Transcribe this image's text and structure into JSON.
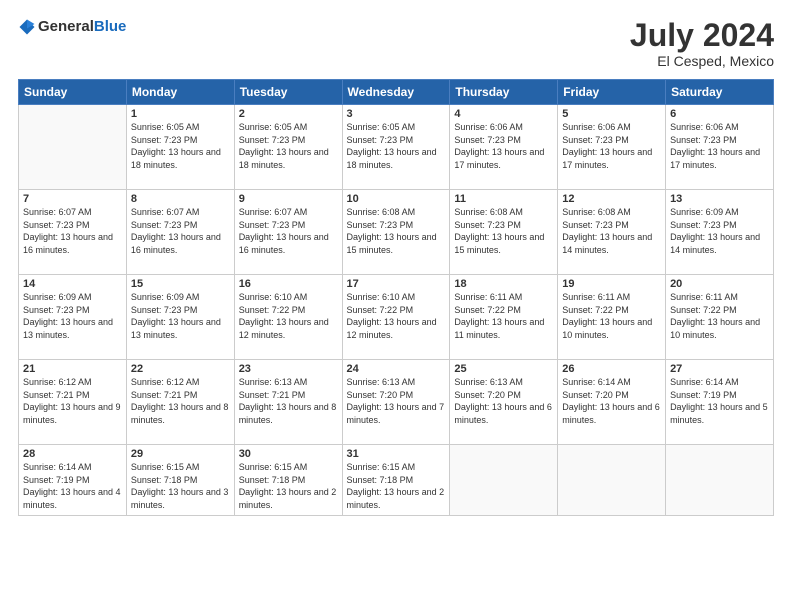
{
  "header": {
    "logo_general": "General",
    "logo_blue": "Blue",
    "month": "July 2024",
    "location": "El Cesped, Mexico"
  },
  "days_of_week": [
    "Sunday",
    "Monday",
    "Tuesday",
    "Wednesday",
    "Thursday",
    "Friday",
    "Saturday"
  ],
  "weeks": [
    [
      {
        "day": "",
        "empty": true
      },
      {
        "day": "1",
        "sunrise": "Sunrise: 6:05 AM",
        "sunset": "Sunset: 7:23 PM",
        "daylight": "Daylight: 13 hours and 18 minutes."
      },
      {
        "day": "2",
        "sunrise": "Sunrise: 6:05 AM",
        "sunset": "Sunset: 7:23 PM",
        "daylight": "Daylight: 13 hours and 18 minutes."
      },
      {
        "day": "3",
        "sunrise": "Sunrise: 6:05 AM",
        "sunset": "Sunset: 7:23 PM",
        "daylight": "Daylight: 13 hours and 18 minutes."
      },
      {
        "day": "4",
        "sunrise": "Sunrise: 6:06 AM",
        "sunset": "Sunset: 7:23 PM",
        "daylight": "Daylight: 13 hours and 17 minutes."
      },
      {
        "day": "5",
        "sunrise": "Sunrise: 6:06 AM",
        "sunset": "Sunset: 7:23 PM",
        "daylight": "Daylight: 13 hours and 17 minutes."
      },
      {
        "day": "6",
        "sunrise": "Sunrise: 6:06 AM",
        "sunset": "Sunset: 7:23 PM",
        "daylight": "Daylight: 13 hours and 17 minutes."
      }
    ],
    [
      {
        "day": "7",
        "sunrise": "Sunrise: 6:07 AM",
        "sunset": "Sunset: 7:23 PM",
        "daylight": "Daylight: 13 hours and 16 minutes."
      },
      {
        "day": "8",
        "sunrise": "Sunrise: 6:07 AM",
        "sunset": "Sunset: 7:23 PM",
        "daylight": "Daylight: 13 hours and 16 minutes."
      },
      {
        "day": "9",
        "sunrise": "Sunrise: 6:07 AM",
        "sunset": "Sunset: 7:23 PM",
        "daylight": "Daylight: 13 hours and 16 minutes."
      },
      {
        "day": "10",
        "sunrise": "Sunrise: 6:08 AM",
        "sunset": "Sunset: 7:23 PM",
        "daylight": "Daylight: 13 hours and 15 minutes."
      },
      {
        "day": "11",
        "sunrise": "Sunrise: 6:08 AM",
        "sunset": "Sunset: 7:23 PM",
        "daylight": "Daylight: 13 hours and 15 minutes."
      },
      {
        "day": "12",
        "sunrise": "Sunrise: 6:08 AM",
        "sunset": "Sunset: 7:23 PM",
        "daylight": "Daylight: 13 hours and 14 minutes."
      },
      {
        "day": "13",
        "sunrise": "Sunrise: 6:09 AM",
        "sunset": "Sunset: 7:23 PM",
        "daylight": "Daylight: 13 hours and 14 minutes."
      }
    ],
    [
      {
        "day": "14",
        "sunrise": "Sunrise: 6:09 AM",
        "sunset": "Sunset: 7:23 PM",
        "daylight": "Daylight: 13 hours and 13 minutes."
      },
      {
        "day": "15",
        "sunrise": "Sunrise: 6:09 AM",
        "sunset": "Sunset: 7:23 PM",
        "daylight": "Daylight: 13 hours and 13 minutes."
      },
      {
        "day": "16",
        "sunrise": "Sunrise: 6:10 AM",
        "sunset": "Sunset: 7:22 PM",
        "daylight": "Daylight: 13 hours and 12 minutes."
      },
      {
        "day": "17",
        "sunrise": "Sunrise: 6:10 AM",
        "sunset": "Sunset: 7:22 PM",
        "daylight": "Daylight: 13 hours and 12 minutes."
      },
      {
        "day": "18",
        "sunrise": "Sunrise: 6:11 AM",
        "sunset": "Sunset: 7:22 PM",
        "daylight": "Daylight: 13 hours and 11 minutes."
      },
      {
        "day": "19",
        "sunrise": "Sunrise: 6:11 AM",
        "sunset": "Sunset: 7:22 PM",
        "daylight": "Daylight: 13 hours and 10 minutes."
      },
      {
        "day": "20",
        "sunrise": "Sunrise: 6:11 AM",
        "sunset": "Sunset: 7:22 PM",
        "daylight": "Daylight: 13 hours and 10 minutes."
      }
    ],
    [
      {
        "day": "21",
        "sunrise": "Sunrise: 6:12 AM",
        "sunset": "Sunset: 7:21 PM",
        "daylight": "Daylight: 13 hours and 9 minutes."
      },
      {
        "day": "22",
        "sunrise": "Sunrise: 6:12 AM",
        "sunset": "Sunset: 7:21 PM",
        "daylight": "Daylight: 13 hours and 8 minutes."
      },
      {
        "day": "23",
        "sunrise": "Sunrise: 6:13 AM",
        "sunset": "Sunset: 7:21 PM",
        "daylight": "Daylight: 13 hours and 8 minutes."
      },
      {
        "day": "24",
        "sunrise": "Sunrise: 6:13 AM",
        "sunset": "Sunset: 7:20 PM",
        "daylight": "Daylight: 13 hours and 7 minutes."
      },
      {
        "day": "25",
        "sunrise": "Sunrise: 6:13 AM",
        "sunset": "Sunset: 7:20 PM",
        "daylight": "Daylight: 13 hours and 6 minutes."
      },
      {
        "day": "26",
        "sunrise": "Sunrise: 6:14 AM",
        "sunset": "Sunset: 7:20 PM",
        "daylight": "Daylight: 13 hours and 6 minutes."
      },
      {
        "day": "27",
        "sunrise": "Sunrise: 6:14 AM",
        "sunset": "Sunset: 7:19 PM",
        "daylight": "Daylight: 13 hours and 5 minutes."
      }
    ],
    [
      {
        "day": "28",
        "sunrise": "Sunrise: 6:14 AM",
        "sunset": "Sunset: 7:19 PM",
        "daylight": "Daylight: 13 hours and 4 minutes."
      },
      {
        "day": "29",
        "sunrise": "Sunrise: 6:15 AM",
        "sunset": "Sunset: 7:18 PM",
        "daylight": "Daylight: 13 hours and 3 minutes."
      },
      {
        "day": "30",
        "sunrise": "Sunrise: 6:15 AM",
        "sunset": "Sunset: 7:18 PM",
        "daylight": "Daylight: 13 hours and 2 minutes."
      },
      {
        "day": "31",
        "sunrise": "Sunrise: 6:15 AM",
        "sunset": "Sunset: 7:18 PM",
        "daylight": "Daylight: 13 hours and 2 minutes."
      },
      {
        "day": "",
        "empty": true
      },
      {
        "day": "",
        "empty": true
      },
      {
        "day": "",
        "empty": true
      }
    ]
  ]
}
